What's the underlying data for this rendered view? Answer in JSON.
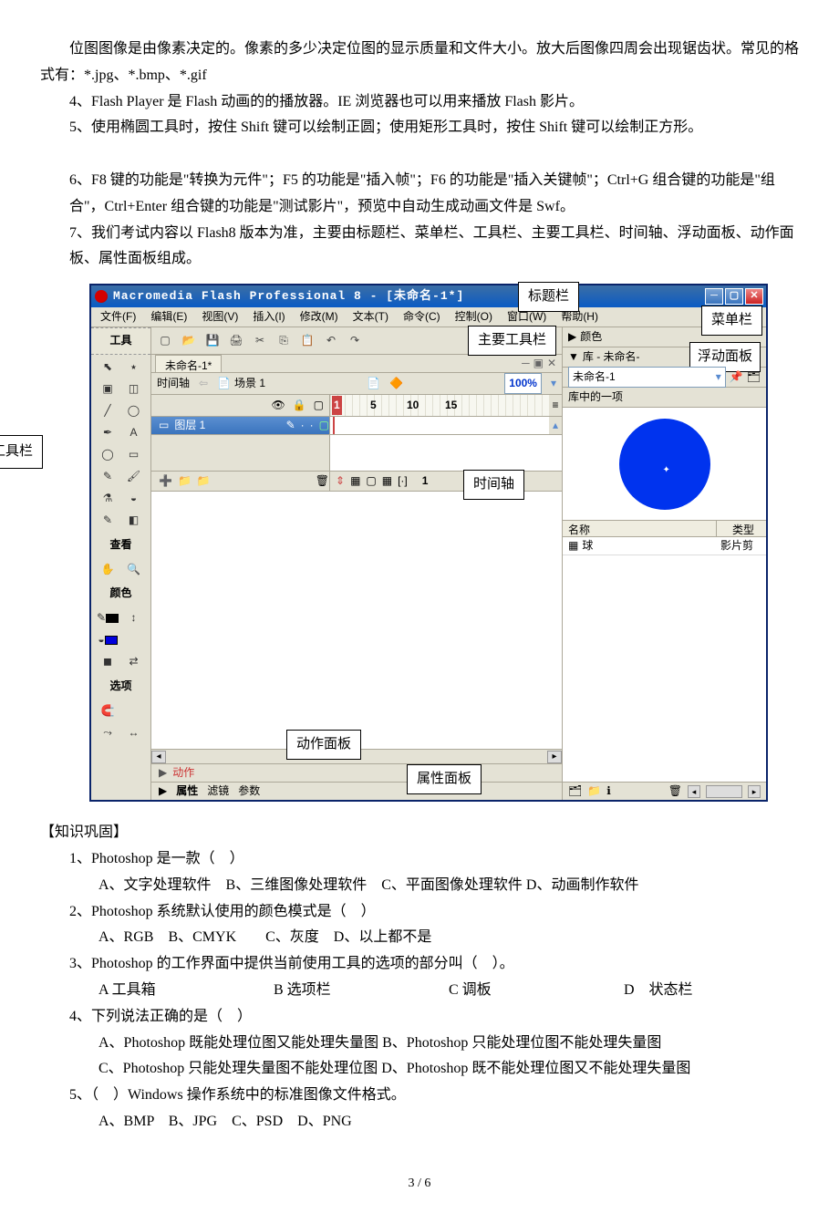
{
  "text_body": {
    "p1": "位图图像是由像素决定的。像素的多少决定位图的显示质量和文件大小。放大后图像四周会出现锯齿状。常见的格式有：*.jpg、*.bmp、*.gif",
    "p2": "4、Flash Player 是 Flash 动画的的播放器。IE 浏览器也可以用来播放 Flash 影片。",
    "p3": "5、使用椭圆工具时，按住 Shift 键可以绘制正圆；使用矩形工具时，按住 Shift 键可以绘制正方形。",
    "p4": "6、F8 键的功能是\"转换为元件\"；F5 的功能是\"插入帧\"；F6 的功能是\"插入关键帧\"；Ctrl+G 组合键的功能是\"组合\"，Ctrl+Enter 组合键的功能是\"测试影片\"，预览中自动生成动画文件是 Swf。",
    "p5": "7、我们考试内容以 Flash8 版本为准，主要由标题栏、菜单栏、工具栏、主要工具栏、时间轴、浮动面板、动作面板、属性面板组成。"
  },
  "callouts": {
    "toolbox": "工具栏",
    "titlebar": "标题栏",
    "menubar": "菜单栏",
    "main_toolbar": "主要工具栏",
    "float_panel": "浮动面板",
    "timeline": "时间轴",
    "action_panel": "动作面板",
    "property_panel": "属性面板"
  },
  "flash": {
    "title": "Macromedia Flash Professional 8 - [未命名-1*]",
    "menus": {
      "file": "文件(F)",
      "edit": "编辑(E)",
      "view": "视图(V)",
      "insert": "插入(I)",
      "modify": "修改(M)",
      "text": "文本(T)",
      "commands": "命令(C)",
      "control": "控制(O)",
      "window": "窗口(W)",
      "help": "帮助(H)"
    },
    "tools_panel_title": "工具",
    "view_label": "查看",
    "color_label": "颜色",
    "options_label": "选项",
    "doc_tab": "未命名-1*",
    "timeline_label": "时间轴",
    "scene_label": "场景 1",
    "zoom": "100%",
    "layer_name": "图层 1",
    "frame_ticks": {
      "t1": "1",
      "t5": "5",
      "t10": "10",
      "t15": "15"
    },
    "frame_indicator": "1",
    "actions_label": "动作",
    "prop_tabs": {
      "props": "属性",
      "filters": "滤镜",
      "params": "参数"
    },
    "right": {
      "color_row": "颜色",
      "library_row": "库 - 未命名-",
      "lib_selected": "未命名-1",
      "lib_count": "库中的一项",
      "name_hdr": "名称",
      "type_hdr": "类型",
      "item_name": "球",
      "item_type": "影片剪"
    }
  },
  "questions": {
    "title": "【知识巩固】",
    "q1": {
      "stem": "1、Photoshop 是一款（　）",
      "opts": "A、文字处理软件　B、三维图像处理软件　C、平面图像处理软件 D、动画制作软件"
    },
    "q2": {
      "stem": "2、Photoshop 系统默认使用的颜色模式是（　）",
      "opts": "A、RGB　B、CMYK　　C、灰度　D、以上都不是"
    },
    "q3": {
      "stem": "3、Photoshop 的工作界面中提供当前使用工具的选项的部分叫（　）。",
      "a": "A 工具箱",
      "b": "B 选项栏",
      "c": "C 调板",
      "d": "D　状态栏"
    },
    "q4": {
      "stem": "4、下列说法正确的是（　）",
      "line1": "A、Photoshop 既能处理位图又能处理失量图 B、Photoshop 只能处理位图不能处理失量图",
      "line2": "C、Photoshop 只能处理失量图不能处理位图 D、Photoshop 既不能处理位图又不能处理失量图"
    },
    "q5": {
      "stem": "5、（　）Windows 操作系统中的标准图像文件格式。",
      "opts": "A、BMP　B、JPG　C、PSD　D、PNG"
    }
  },
  "footer": "3 / 6"
}
